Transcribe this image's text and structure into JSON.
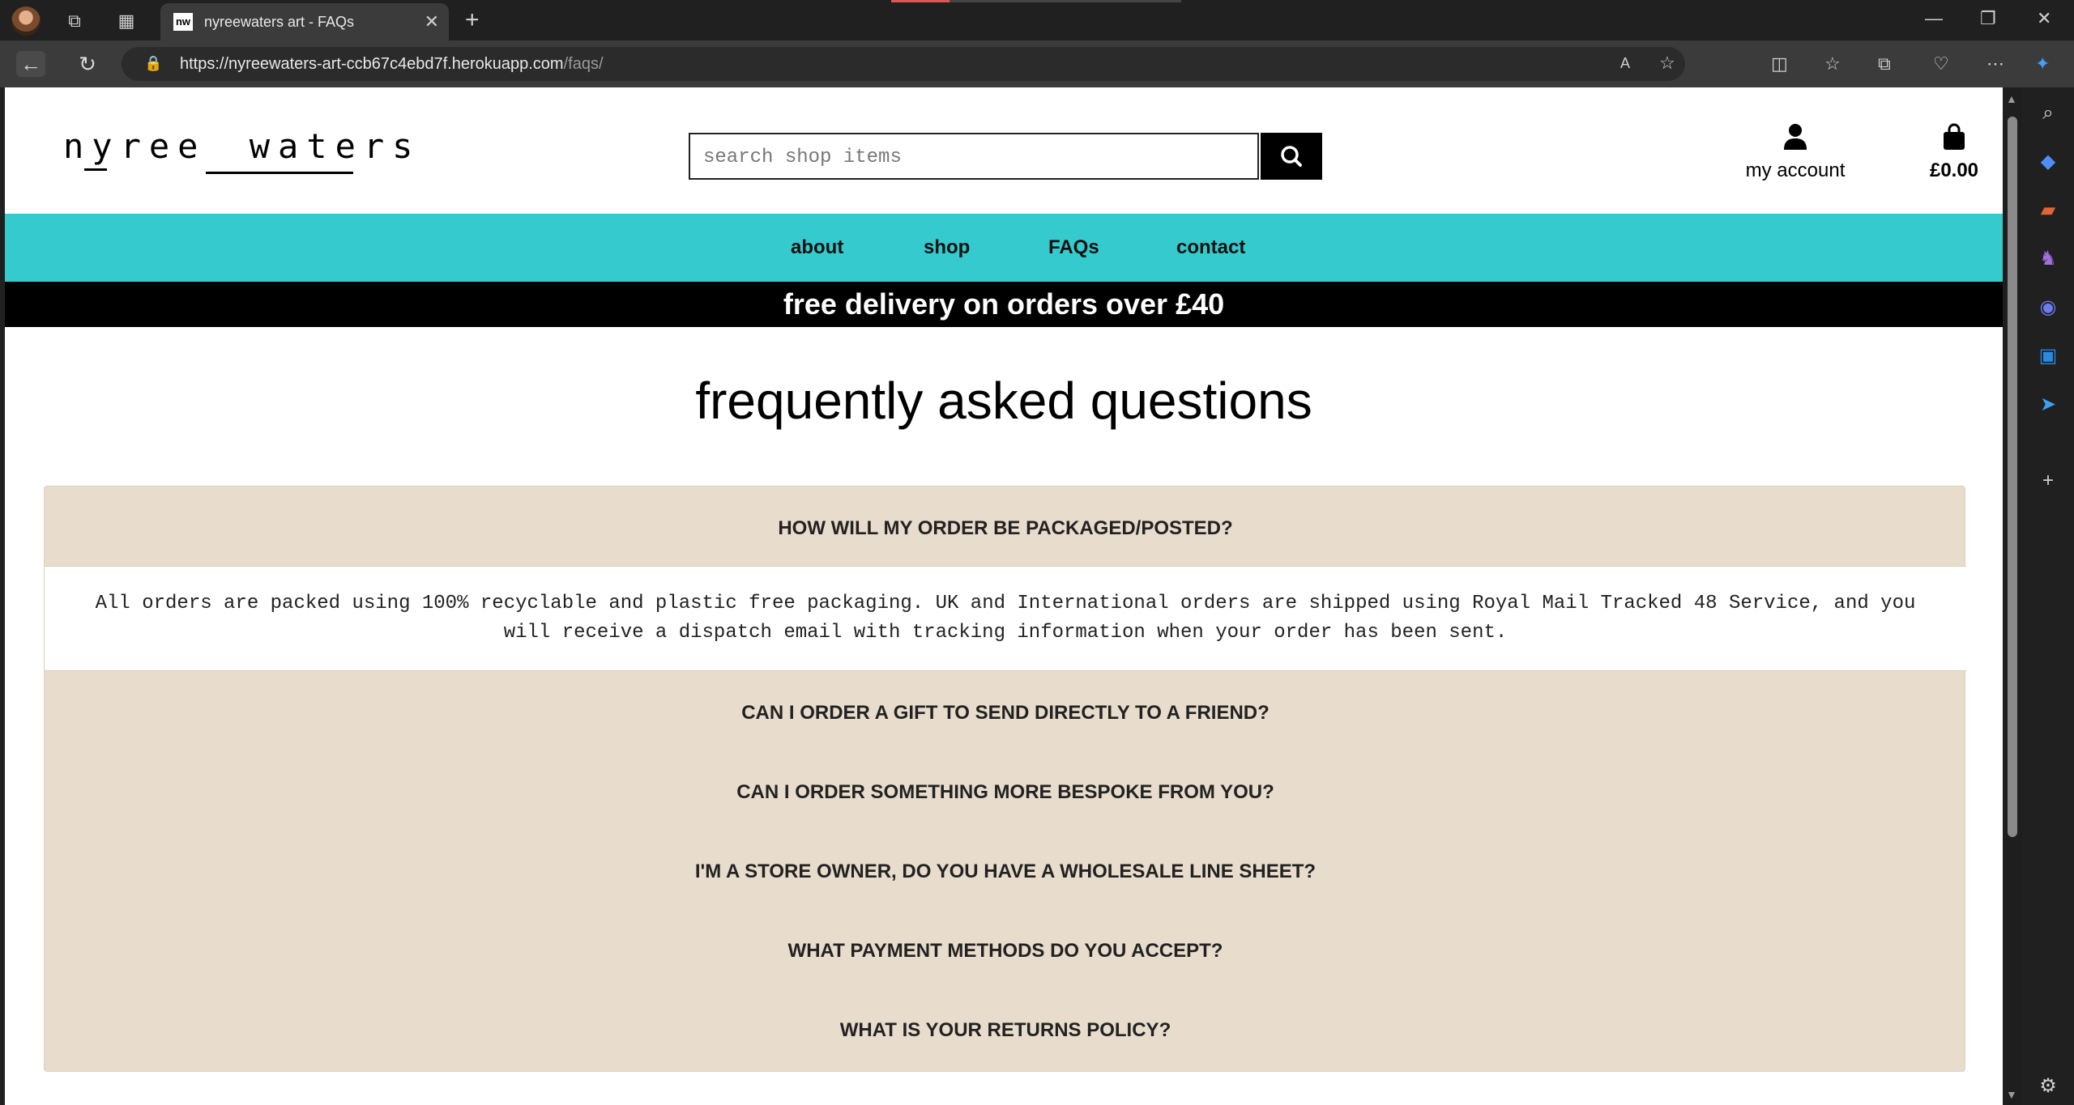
{
  "browser": {
    "tab_title": "nyreewaters art - FAQs",
    "tab_favicon": "nw",
    "url_host": "https://nyreewaters-art-ccb67c4ebd7f.herokuapp.com",
    "url_path": "/faqs/"
  },
  "header": {
    "logo_text_1": "nyree",
    "logo_text_2": "waters",
    "search_placeholder": "search shop items",
    "account_label": "my account",
    "bag_total": "£0.00"
  },
  "nav": {
    "items": [
      "about",
      "shop",
      "FAQs",
      "contact"
    ]
  },
  "promo": {
    "text": "free delivery on orders over £40"
  },
  "main": {
    "title": "frequently asked questions",
    "faqs": [
      {
        "question": "HOW WILL MY ORDER BE PACKAGED/POSTED?",
        "answer": "All orders are packed using 100% recyclable and plastic free packaging. UK and International orders are shipped using Royal Mail Tracked 48 Service, and you will receive a dispatch email with tracking information when your order has been sent."
      },
      {
        "question": "CAN I ORDER A GIFT TO SEND DIRECTLY TO A FRIEND?"
      },
      {
        "question": "CAN I ORDER SOMETHING MORE BESPOKE FROM YOU?"
      },
      {
        "question": "I'M A STORE OWNER, DO YOU HAVE A WHOLESALE LINE SHEET?"
      },
      {
        "question": "WHAT PAYMENT METHODS DO YOU ACCEPT?"
      },
      {
        "question": "WHAT IS YOUR RETURNS POLICY?"
      }
    ]
  },
  "colors": {
    "nav_bg": "#35cbce",
    "faq_bg": "#e8dccc",
    "promo_bg": "#000000"
  }
}
